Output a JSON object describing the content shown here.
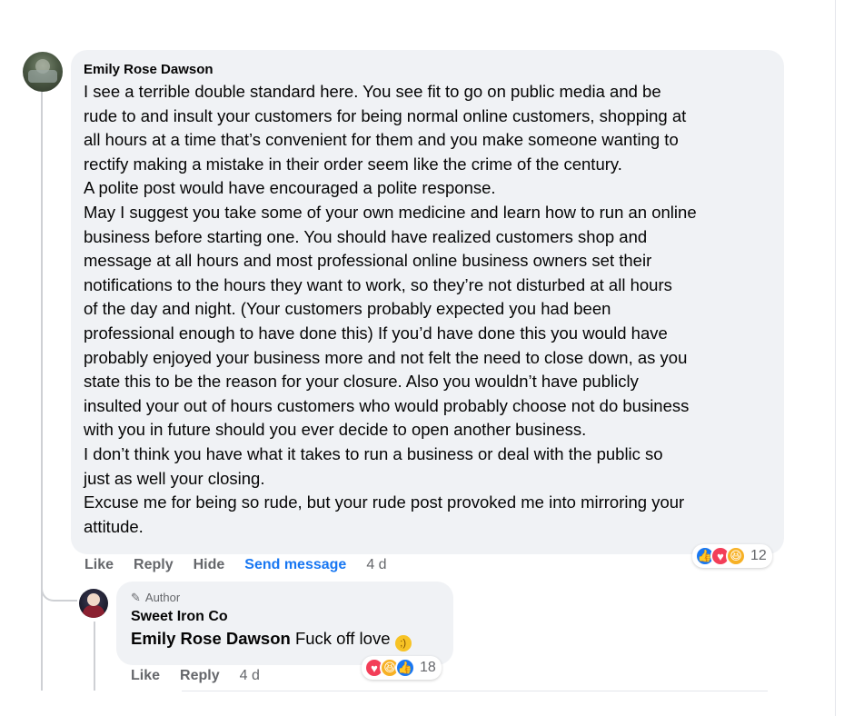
{
  "main_comment": {
    "author": "Emily Rose Dawson",
    "text": "I see a terrible double standard here. You see fit to go on public media and be\nrude to and insult your customers for being normal online customers, shopping at\nall hours at a time that’s convenient for them and you make someone wanting to\nrectify making a mistake in their order seem like the crime of the century.\nA polite post would have encouraged a polite response.\nMay I suggest you take some of your own medicine and learn how to run an online\nbusiness before starting one. You should have realized customers shop and\nmessage at all hours and most professional online business owners set their\nnotifications to the hours they want to work, so they’re not disturbed at all hours\nof the day and night. (Your customers probably expected you had been\nprofessional enough to have done this) If you’d have done this you would have\nprobably enjoyed your business more and not felt the need to close down, as you\nstate this to be the reason for your closure. Also you wouldn’t have publicly\ninsulted your out of hours customers who would probably choose not do business\nwith you in future should you ever decide to open another business.\nI don’t think you have what it takes to run a business or deal with the public so\njust as well your closing.\nExcuse me for being so rude, but your rude post provoked me into mirroring your\nattitude.",
    "actions": {
      "like": "Like",
      "reply": "Reply",
      "hide": "Hide",
      "send_message": "Send message",
      "time": "4 d"
    },
    "reactions": {
      "icons": [
        "like-icon",
        "love-icon",
        "haha-icon"
      ],
      "count": "12"
    }
  },
  "reply_comment": {
    "badge": "Author",
    "author": "Sweet Iron Co",
    "mention": "Emily Rose Dawson",
    "text": " Fuck off love ",
    "emoji": "winking-face-icon",
    "actions": {
      "like": "Like",
      "reply": "Reply",
      "time": "4 d"
    },
    "reactions": {
      "icons": [
        "love-icon",
        "haha-icon",
        "like-icon"
      ],
      "count": "18"
    }
  },
  "colors": {
    "bubble": "#f0f2f5",
    "link_blue": "#1877f2",
    "muted": "#65676b"
  }
}
